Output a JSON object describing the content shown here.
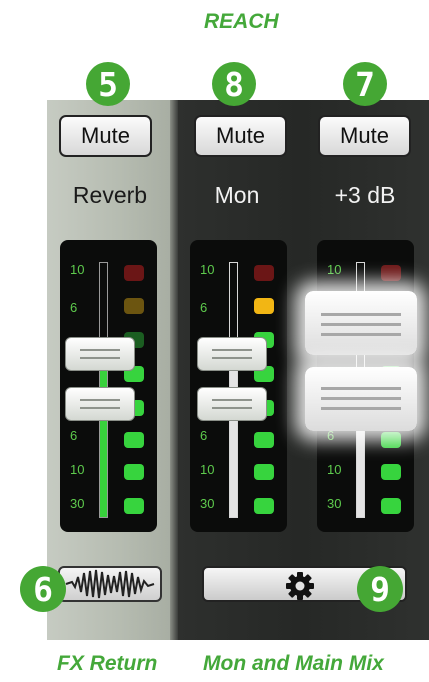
{
  "captions": {
    "top": "REACH",
    "fx": "FX Return",
    "mix": "Mon and Main Mix"
  },
  "badges": {
    "fx_mute": "5",
    "mon_mute": "8",
    "main_mute": "7",
    "fx_button": "6",
    "settings": "9"
  },
  "channels": {
    "fx": {
      "mute_label": "Mute",
      "label": "Reverb"
    },
    "mon": {
      "mute_label": "Mute",
      "label": "Mon"
    },
    "main": {
      "mute_label": "Mute",
      "label": "+3 dB"
    }
  },
  "meter_ticks": [
    "10",
    "6",
    "6",
    "10",
    "30"
  ],
  "icons": {
    "waveform": "waveform-icon",
    "settings": "gear-icon"
  },
  "colors": {
    "caption_green": "#44a83a",
    "badge_green": "#45a734",
    "led_green": "#37d43e",
    "led_yellow": "#f2b614",
    "led_red": "#6b1616"
  }
}
